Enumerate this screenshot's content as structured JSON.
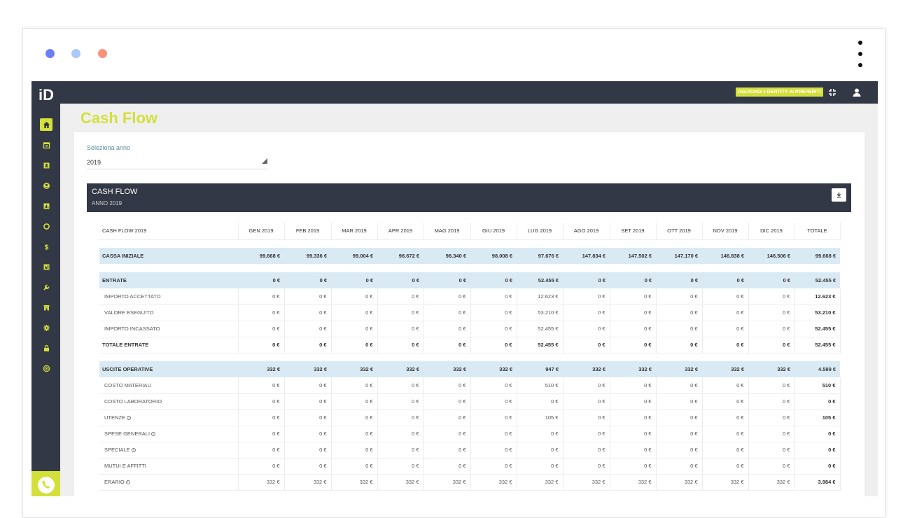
{
  "window": {
    "dots": [
      "#6c7ff2",
      "#a9c8fb",
      "#f8937a"
    ]
  },
  "topbar": {
    "logo": "iD",
    "favorites_label": "AGGIUNGI I-DENTITY AI PREFERITI"
  },
  "sidebar": {
    "items": [
      "home-icon",
      "calendar-icon",
      "contacts-icon",
      "user-icon",
      "chart-icon",
      "refresh-icon",
      "dollar-icon",
      "report-icon",
      "wrench-icon",
      "store-icon",
      "settings-icon",
      "lock-icon",
      "target-icon"
    ],
    "phone": "phone-icon"
  },
  "page": {
    "title": "Cash Flow"
  },
  "selector": {
    "label": "Seleziona anno",
    "value": "2019"
  },
  "panel": {
    "title": "CASH FLOW",
    "subtitle": "ANNO 2019"
  },
  "table": {
    "headers": [
      "CASH FLOW 2019",
      "GEN 2019",
      "FEB 2019",
      "MAR 2019",
      "APR 2019",
      "MAG 2019",
      "GIU 2019",
      "LUG 2019",
      "AGO 2019",
      "SET 2019",
      "OTT 2019",
      "NOV 2019",
      "DIC 2019",
      "TOTALE"
    ],
    "rows": [
      {
        "type": "spacer"
      },
      {
        "type": "section",
        "label": "CASSA INIZIALE",
        "values": [
          "99.668 €",
          "99.336 €",
          "99.004 €",
          "98.672 €",
          "98.340 €",
          "98.008 €",
          "97.676 €",
          "147.834 €",
          "147.502 €",
          "147.170 €",
          "146.838 €",
          "146.506 €",
          "99.668 €"
        ]
      },
      {
        "type": "spacer"
      },
      {
        "type": "section",
        "label": "ENTRATE",
        "values": [
          "0 €",
          "0 €",
          "0 €",
          "0 €",
          "0 €",
          "0 €",
          "52.455 €",
          "0 €",
          "0 €",
          "0 €",
          "0 €",
          "0 €",
          "52.455 €"
        ]
      },
      {
        "type": "sub",
        "label": "IMPORTO ACCETTATO",
        "values": [
          "0 €",
          "0 €",
          "0 €",
          "0 €",
          "0 €",
          "0 €",
          "12.623 €",
          "0 €",
          "0 €",
          "0 €",
          "0 €",
          "0 €",
          "12.623 €"
        ]
      },
      {
        "type": "sub",
        "label": "VALORE ESEGUITO",
        "values": [
          "0 €",
          "0 €",
          "0 €",
          "0 €",
          "0 €",
          "0 €",
          "53.210 €",
          "0 €",
          "0 €",
          "0 €",
          "0 €",
          "0 €",
          "53.210 €"
        ]
      },
      {
        "type": "sub",
        "label": "IMPORTO INCASSATO",
        "values": [
          "0 €",
          "0 €",
          "0 €",
          "0 €",
          "0 €",
          "0 €",
          "52.455 €",
          "0 €",
          "0 €",
          "0 €",
          "0 €",
          "0 €",
          "52.455 €"
        ]
      },
      {
        "type": "total",
        "label": "TOTALE ENTRATE",
        "values": [
          "0 €",
          "0 €",
          "0 €",
          "0 €",
          "0 €",
          "0 €",
          "52.455 €",
          "0 €",
          "0 €",
          "0 €",
          "0 €",
          "0 €",
          "52.455 €"
        ]
      },
      {
        "type": "spacer"
      },
      {
        "type": "section",
        "label": "USCITE OPERATIVE",
        "values": [
          "332 €",
          "332 €",
          "332 €",
          "332 €",
          "332 €",
          "332 €",
          "947 €",
          "332 €",
          "332 €",
          "332 €",
          "332 €",
          "332 €",
          "4.599 €"
        ]
      },
      {
        "type": "sub",
        "label": "COSTO MATERIALI",
        "values": [
          "0 €",
          "0 €",
          "0 €",
          "0 €",
          "0 €",
          "0 €",
          "510 €",
          "0 €",
          "0 €",
          "0 €",
          "0 €",
          "0 €",
          "510 €"
        ]
      },
      {
        "type": "sub",
        "label": "COSTO LABORATORIO",
        "values": [
          "0 €",
          "0 €",
          "0 €",
          "0 €",
          "0 €",
          "0 €",
          "0 €",
          "0 €",
          "0 €",
          "0 €",
          "0 €",
          "0 €",
          "0 €"
        ]
      },
      {
        "type": "sub",
        "label": "UTENZE",
        "info": true,
        "values": [
          "0 €",
          "0 €",
          "0 €",
          "0 €",
          "0 €",
          "0 €",
          "105 €",
          "0 €",
          "0 €",
          "0 €",
          "0 €",
          "0 €",
          "105 €"
        ]
      },
      {
        "type": "sub",
        "label": "SPESE GENERALI",
        "info": true,
        "values": [
          "0 €",
          "0 €",
          "0 €",
          "0 €",
          "0 €",
          "0 €",
          "0 €",
          "0 €",
          "0 €",
          "0 €",
          "0 €",
          "0 €",
          "0 €"
        ]
      },
      {
        "type": "sub",
        "label": "SPECIALE",
        "info": true,
        "values": [
          "0 €",
          "0 €",
          "0 €",
          "0 €",
          "0 €",
          "0 €",
          "0 €",
          "0 €",
          "0 €",
          "0 €",
          "0 €",
          "0 €",
          "0 €"
        ]
      },
      {
        "type": "sub",
        "label": "MUTUI E AFFITTI",
        "values": [
          "0 €",
          "0 €",
          "0 €",
          "0 €",
          "0 €",
          "0 €",
          "0 €",
          "0 €",
          "0 €",
          "0 €",
          "0 €",
          "0 €",
          "0 €"
        ]
      },
      {
        "type": "sub",
        "label": "ERARIO",
        "info": true,
        "values": [
          "332 €",
          "332 €",
          "332 €",
          "332 €",
          "332 €",
          "332 €",
          "332 €",
          "332 €",
          "332 €",
          "332 €",
          "332 €",
          "332 €",
          "3.984 €"
        ]
      }
    ]
  },
  "colors": {
    "accent": "#d3e03a",
    "dark": "#323845",
    "section_bg": "#daeaf4"
  }
}
